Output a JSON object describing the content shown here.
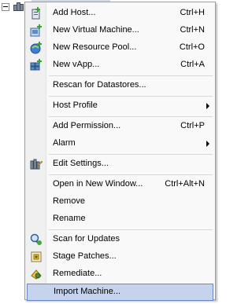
{
  "menu": {
    "items": [
      {
        "label": "Add Host...",
        "shortcut": "Ctrl+H",
        "icon": "add-host-icon"
      },
      {
        "label": "New Virtual Machine...",
        "shortcut": "Ctrl+N",
        "icon": "new-vm-icon"
      },
      {
        "label": "New Resource Pool...",
        "shortcut": "Ctrl+O",
        "icon": "resource-pool-icon"
      },
      {
        "label": "New vApp...",
        "shortcut": "Ctrl+A",
        "icon": "vapp-icon"
      },
      {
        "label": "Rescan for Datastores...",
        "shortcut": "",
        "icon": ""
      },
      {
        "label": "Host Profile",
        "shortcut": "",
        "icon": "",
        "submenu": true
      },
      {
        "label": "Add Permission...",
        "shortcut": "Ctrl+P",
        "icon": ""
      },
      {
        "label": "Alarm",
        "shortcut": "",
        "icon": "",
        "submenu": true
      },
      {
        "label": "Edit Settings...",
        "shortcut": "",
        "icon": "edit-settings-icon"
      },
      {
        "label": "Open in New Window...",
        "shortcut": "Ctrl+Alt+N",
        "icon": ""
      },
      {
        "label": "Remove",
        "shortcut": "",
        "icon": ""
      },
      {
        "label": "Rename",
        "shortcut": "",
        "icon": ""
      },
      {
        "label": "Scan for Updates",
        "shortcut": "",
        "icon": "scan-updates-icon"
      },
      {
        "label": "Stage Patches...",
        "shortcut": "",
        "icon": "stage-patches-icon"
      },
      {
        "label": "Remediate...",
        "shortcut": "",
        "icon": "remediate-icon"
      },
      {
        "label": "Import Machine...",
        "shortcut": "",
        "icon": "import-machine-icon",
        "highlighted": true
      }
    ]
  },
  "colors": {
    "menu_bg": "#f9f9f9",
    "highlight_bg": "#c6d3ec",
    "highlight_border": "#6b87c0"
  }
}
